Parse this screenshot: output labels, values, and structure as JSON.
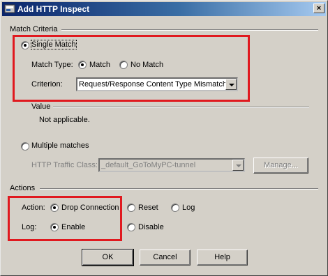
{
  "window": {
    "title": "Add HTTP Inspect",
    "close_glyph": "×",
    "app_icon": "asdm-app-icon"
  },
  "match_criteria": {
    "label": "Match Criteria",
    "single_match": {
      "label": "Single Match",
      "checked": true
    },
    "match_type": {
      "label": "Match Type:",
      "options": [
        {
          "label": "Match",
          "checked": true
        },
        {
          "label": "No Match",
          "checked": false
        }
      ]
    },
    "criterion": {
      "label": "Criterion:",
      "value": "Request/Response Content Type Mismatch"
    },
    "value": {
      "label": "Value",
      "text": "Not applicable."
    },
    "multiple_matches": {
      "label": "Multiple matches",
      "checked": false,
      "traffic_class_label": "HTTP Traffic Class:",
      "traffic_class_value": "_default_GoToMyPC-tunnel",
      "manage_label": "Manage..."
    }
  },
  "actions": {
    "label": "Actions",
    "action": {
      "label": "Action:",
      "options": [
        {
          "label": "Drop Connection",
          "checked": true
        },
        {
          "label": "Reset",
          "checked": false
        },
        {
          "label": "Log",
          "checked": false
        }
      ]
    },
    "log": {
      "label": "Log:",
      "options": [
        {
          "label": "Enable",
          "checked": true
        },
        {
          "label": "Disable",
          "checked": false
        }
      ]
    }
  },
  "buttons": {
    "ok": "OK",
    "cancel": "Cancel",
    "help": "Help"
  },
  "annotation_color": "#e0191f"
}
